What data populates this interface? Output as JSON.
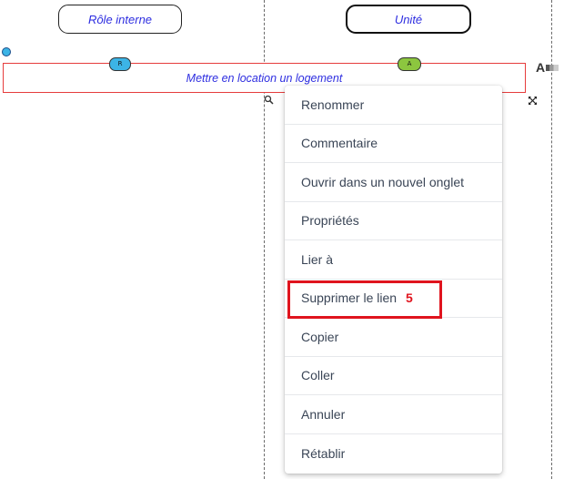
{
  "lanes": {
    "left": {
      "title": "Rôle interne"
    },
    "right": {
      "title": "Unité"
    }
  },
  "activity": {
    "label": "Mettre en location un logement",
    "raci_left": "R",
    "raci_right": "A"
  },
  "toolbar": {
    "text_tool_label": "A"
  },
  "context_menu": {
    "items": [
      {
        "label": "Renommer"
      },
      {
        "label": "Commentaire"
      },
      {
        "label": "Ouvrir dans un nouvel onglet"
      },
      {
        "label": "Propriétés"
      },
      {
        "label": "Lier à"
      },
      {
        "label": "Supprimer le lien"
      },
      {
        "label": "Copier"
      },
      {
        "label": "Coller"
      },
      {
        "label": "Annuler"
      },
      {
        "label": "Rétablir"
      }
    ]
  },
  "annotation": {
    "step_number": "5",
    "color": "#e0141e"
  },
  "colors": {
    "lane_text": "#2d2de0",
    "activity_border": "#e63c3c",
    "pill_r": "#3cb4e6",
    "pill_a": "#8cc63f",
    "menu_text": "#3a4556"
  }
}
